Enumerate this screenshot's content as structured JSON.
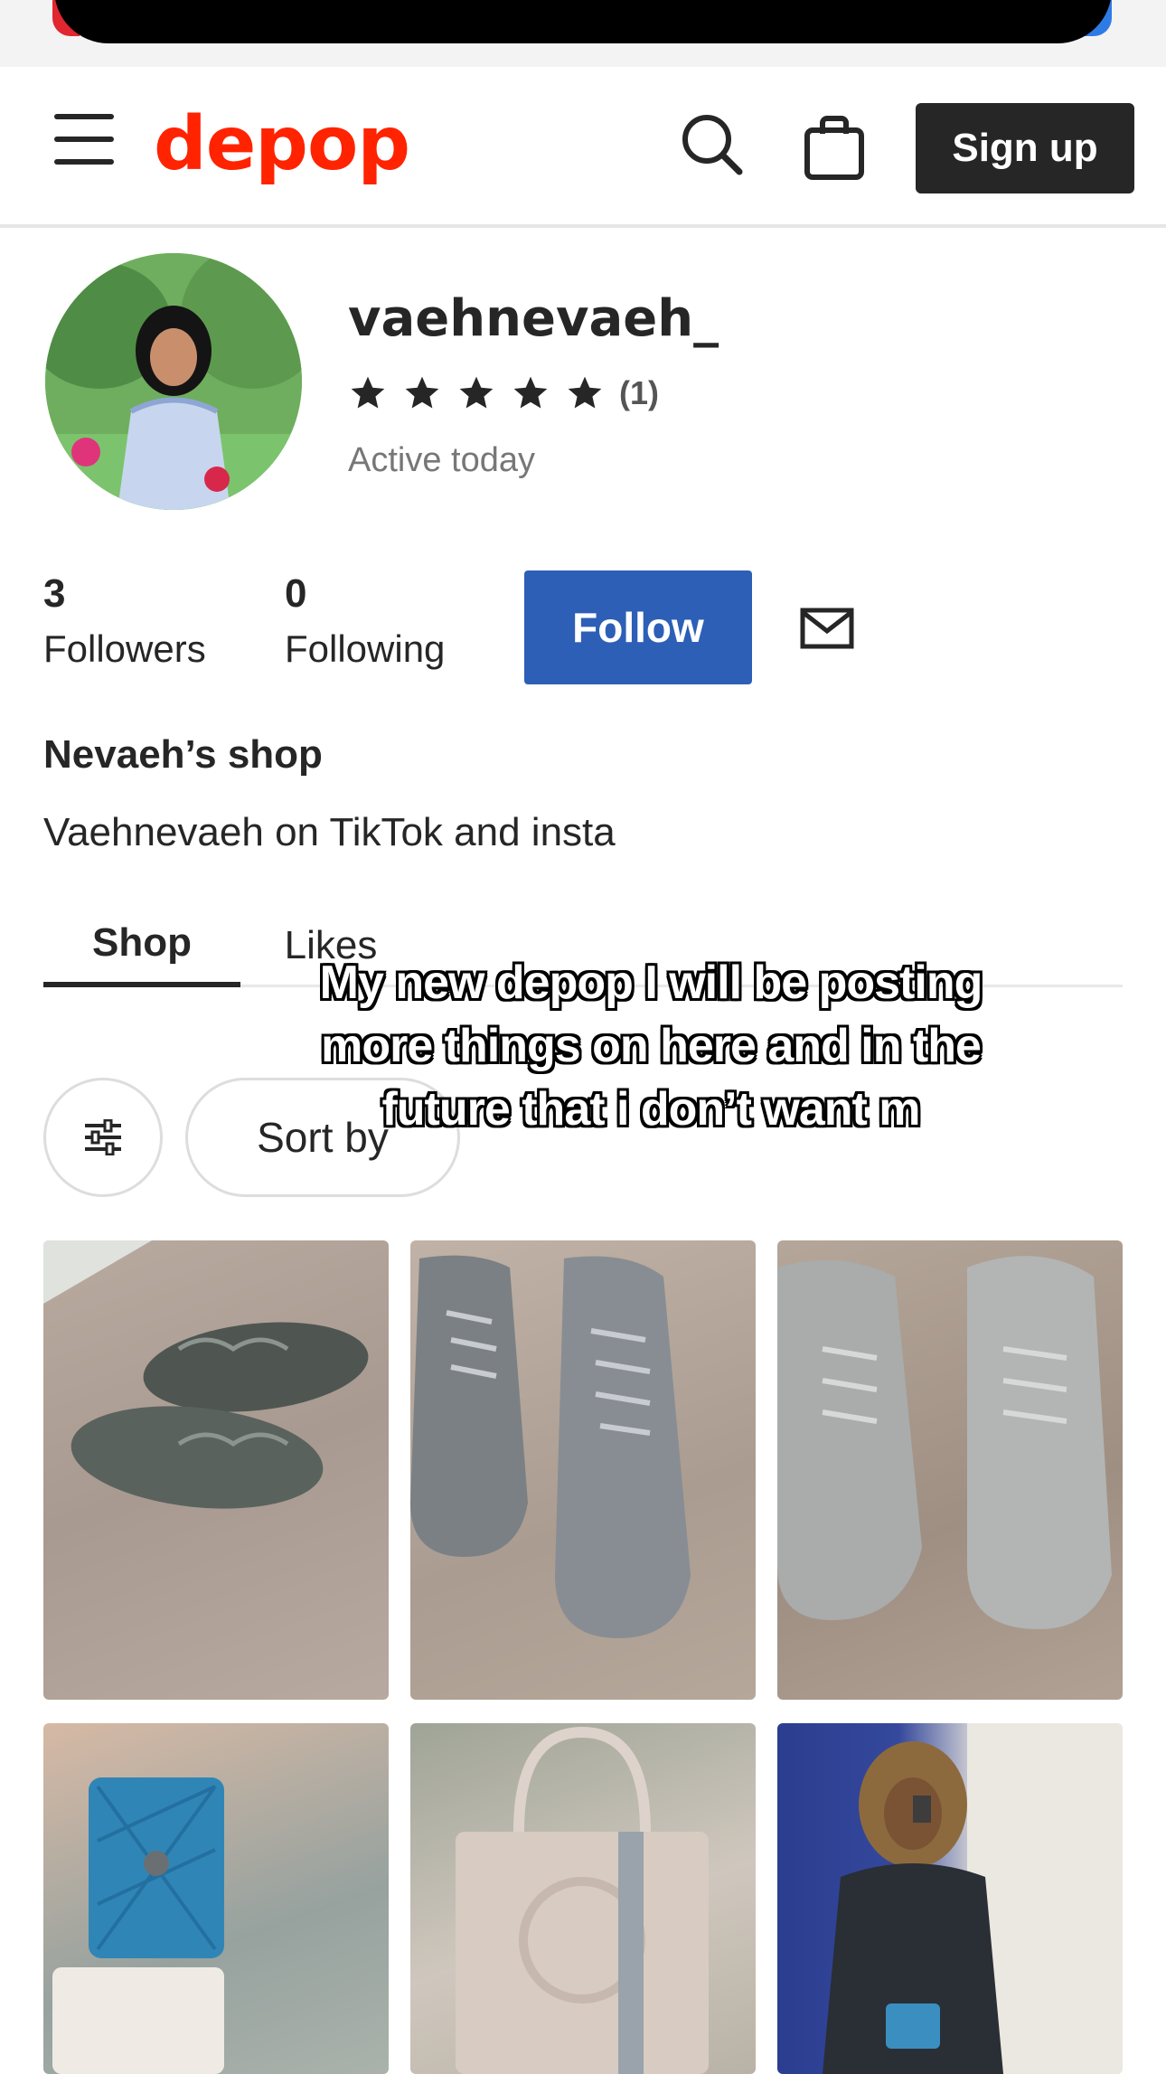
{
  "header": {
    "logo": "depop",
    "signup_label": "Sign up"
  },
  "profile": {
    "username": "vaehnevaeh_",
    "rating": 5,
    "rating_count": "(1)",
    "status": "Active today",
    "followers_count": "3",
    "followers_label": "Followers",
    "following_count": "0",
    "following_label": "Following",
    "follow_label": "Follow",
    "shop_name": "Nevaeh’s shop",
    "bio": "Vaehnevaeh on TikTok and insta"
  },
  "tabs": [
    {
      "label": "Shop",
      "active": true
    },
    {
      "label": "Likes",
      "active": false
    }
  ],
  "controls": {
    "sort_label": "Sort by"
  },
  "caption": "My new depop I will be posting more things on here and in the future that i don’t want m",
  "colors": {
    "brand": "#ff2300",
    "follow_button": "#2d5fb7",
    "text": "#262626"
  },
  "products": [
    {
      "image": "grey yeezy 450 sneakers on carpet"
    },
    {
      "image": "grey jordan 4 sneakers on carpet"
    },
    {
      "image": "grey desert boots on carpet"
    },
    {
      "image": "blue quilted crossbody bag"
    },
    {
      "image": "beige tote bag"
    },
    {
      "image": "mirror selfie with blue bag"
    }
  ]
}
